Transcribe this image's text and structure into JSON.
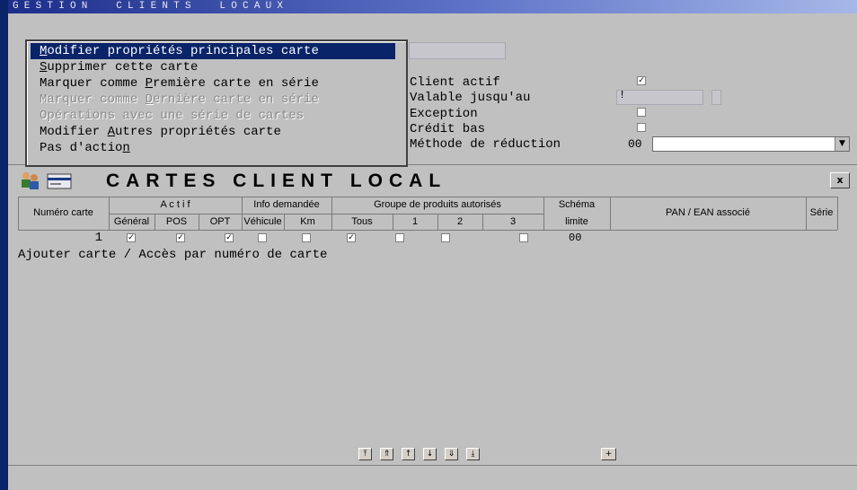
{
  "window": {
    "title": "GESTION  CLIENTS  LOCAUX"
  },
  "form": {
    "client_actif_label": "Client actif",
    "valable_label": "Valable jusqu'au",
    "valable_value": "!",
    "exception_label": "Exception",
    "credit_bas_label": "Crédit bas",
    "methode_label": "Méthode de réduction",
    "methode_code": "00",
    "client_actif_checked": true,
    "exception_checked": false,
    "credit_bas_checked": false
  },
  "menu": {
    "items": [
      {
        "pre": "",
        "key": "M",
        "post": "odifier propriétés principales carte",
        "state": "selected"
      },
      {
        "pre": "",
        "key": "S",
        "post": "upprimer cette carte",
        "state": "enabled"
      },
      {
        "pre": "Marquer comme ",
        "key": "P",
        "post": "remière carte en série",
        "state": "enabled"
      },
      {
        "pre": "Marquer comme ",
        "key": "D",
        "post": "ernière carte en série",
        "state": "disabled"
      },
      {
        "pre": "Opérations avec une série de cartes",
        "key": "",
        "post": "",
        "state": "disabled"
      },
      {
        "pre": "Modifier ",
        "key": "A",
        "post": "utres propriétés carte",
        "state": "enabled"
      },
      {
        "pre": "Pas d'actio",
        "key": "n",
        "post": "",
        "state": "enabled"
      }
    ]
  },
  "panel": {
    "title": "CARTES CLIENT LOCAL",
    "close_label": "x",
    "headers": {
      "numero": "Numéro carte",
      "actif": "A c t i f",
      "general": "Général",
      "pos": "POS",
      "opt": "OPT",
      "info": "Info demandée",
      "vehicule": "Véhicule",
      "km": "Km",
      "groupe": "Groupe de produits autorisés",
      "tous": "Tous",
      "g1": "1",
      "g2": "2",
      "g3": "3",
      "schema": "Schéma",
      "limite": "limite",
      "pan": "PAN / EAN  associé",
      "serie": "Série"
    },
    "rows": [
      {
        "numero": "1",
        "general": true,
        "pos": true,
        "opt": true,
        "vehicule": false,
        "km": false,
        "tous": true,
        "g1": false,
        "g2": false,
        "g3": false,
        "schema": "00"
      }
    ],
    "add_line": "Ajouter carte / Accès par numéro de carte"
  },
  "nav": {
    "buttons": [
      "first-page-icon",
      "page-up-icon",
      "line-up-icon",
      "line-down-icon",
      "page-down-icon",
      "last-page-icon"
    ],
    "add_button": "+"
  },
  "colors": {
    "title_bar": "#1c2e8a",
    "selection": "#0a246a",
    "background": "#c0c0c0"
  }
}
